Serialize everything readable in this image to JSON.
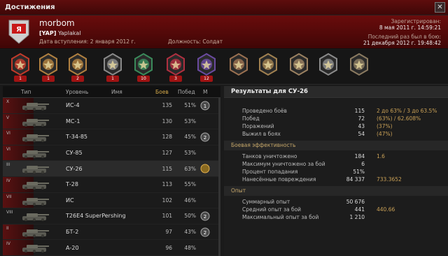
{
  "window": {
    "title": "Достижения"
  },
  "header": {
    "player_name": "morbom",
    "clan_tag": "[YAP]",
    "clan_name": "Yaplakal",
    "joined_label": "Дата вступления:",
    "joined_date": "2 января 2012 г.",
    "position_label": "Должность:",
    "position_value": "Солдат",
    "registered_label": "Зарегистрирован:",
    "registered_value": "8 мая 2011 г. 14:59:21",
    "last_battle_label": "Последний раз был в бою:",
    "last_battle_value": "21 декабря 2012 г. 19:48:42",
    "emblem_text": "Я"
  },
  "medals": [
    {
      "name": "medal-order-icon",
      "count": "1",
      "color": "#c23a2a"
    },
    {
      "name": "medal-tank-icon",
      "count": "1",
      "color": "#b08040"
    },
    {
      "name": "medal-tank2-icon",
      "count": "2",
      "color": "#b08040"
    },
    {
      "name": "medal-tank3-icon",
      "count": "1",
      "color": "#8a8a8a"
    },
    {
      "name": "medal-green-ribbon-icon",
      "count": "10",
      "color": "#3a8a5a"
    },
    {
      "name": "medal-red-ribbon-icon",
      "count": "3",
      "color": "#b03040"
    },
    {
      "name": "medal-purple-ribbon-icon",
      "count": "12",
      "color": "#6a4aa0"
    },
    {
      "name": "medal-bronze-icon",
      "count": "",
      "color": "#9a7050"
    },
    {
      "name": "medal-cross-icon",
      "count": "",
      "color": "#a08050"
    },
    {
      "name": "medal-star-icon",
      "count": "",
      "color": "#9a8060"
    },
    {
      "name": "medal-cross2-icon",
      "count": "",
      "color": "#8a8a8a"
    },
    {
      "name": "medal-star2-icon",
      "count": "",
      "color": "#8a7a60"
    }
  ],
  "table": {
    "headers": {
      "type": "Тип",
      "level": "Уровень",
      "name": "Имя",
      "battles": "Боев",
      "wins": "Побед",
      "mastery": "М"
    },
    "rows": [
      {
        "tier": "X",
        "name": "ИС-4",
        "battles": "135",
        "wins": "51%",
        "mastery": "1",
        "red": true
      },
      {
        "tier": "V",
        "name": "МС-1",
        "battles": "130",
        "wins": "53%",
        "mastery": "",
        "red": true
      },
      {
        "tier": "VI",
        "name": "Т-34-85",
        "battles": "128",
        "wins": "45%",
        "mastery": "2",
        "red": true
      },
      {
        "tier": "VI",
        "name": "СУ-85",
        "battles": "127",
        "wins": "53%",
        "mastery": "",
        "red": true
      },
      {
        "tier": "III",
        "name": "СУ-26",
        "battles": "115",
        "wins": "63%",
        "mastery": "gold",
        "red": false,
        "sel": true
      },
      {
        "tier": "IV",
        "name": "Т-28",
        "battles": "113",
        "wins": "55%",
        "mastery": "",
        "red": true
      },
      {
        "tier": "VII",
        "name": "ИС",
        "battles": "102",
        "wins": "46%",
        "mastery": "",
        "red": true
      },
      {
        "tier": "VIII",
        "name": "T26E4 SuperPershing",
        "battles": "101",
        "wins": "50%",
        "mastery": "2",
        "red": false
      },
      {
        "tier": "II",
        "name": "БТ-2",
        "battles": "97",
        "wins": "43%",
        "mastery": "2",
        "red": true
      },
      {
        "tier": "IV",
        "name": "А-20",
        "battles": "96",
        "wins": "48%",
        "mastery": "",
        "red": true
      }
    ]
  },
  "results": {
    "title": "Результаты для СУ-26",
    "rows1": [
      {
        "label": "Проведено боёв",
        "value": "115",
        "extra": "2 до 63% / 3 до 63.5%"
      },
      {
        "label": "Побед",
        "value": "72",
        "extra": "(63%)  /  62.608%"
      },
      {
        "label": "Поражений",
        "value": "43",
        "extra": "(37%)"
      },
      {
        "label": "Выжил в боях",
        "value": "54",
        "extra": "(47%)"
      }
    ],
    "section2": "Боевая эффективность",
    "rows2": [
      {
        "label": "Танков уничтожено",
        "value": "184",
        "extra": "1.6"
      },
      {
        "label": "Максимум уничтожено за бой",
        "value": "6",
        "extra": ""
      },
      {
        "label": "Процент попадания",
        "value": "51%",
        "extra": ""
      },
      {
        "label": "Нанесённые повреждения",
        "value": "84 337",
        "extra": "733.3652"
      }
    ],
    "section3": "Опыт",
    "rows3": [
      {
        "label": "Суммарный опыт",
        "value": "50 676",
        "extra": ""
      },
      {
        "label": "Средний опыт за бой",
        "value": "441",
        "extra": "440.66"
      },
      {
        "label": "Максимальный опыт за бой",
        "value": "1 210",
        "extra": ""
      }
    ]
  }
}
